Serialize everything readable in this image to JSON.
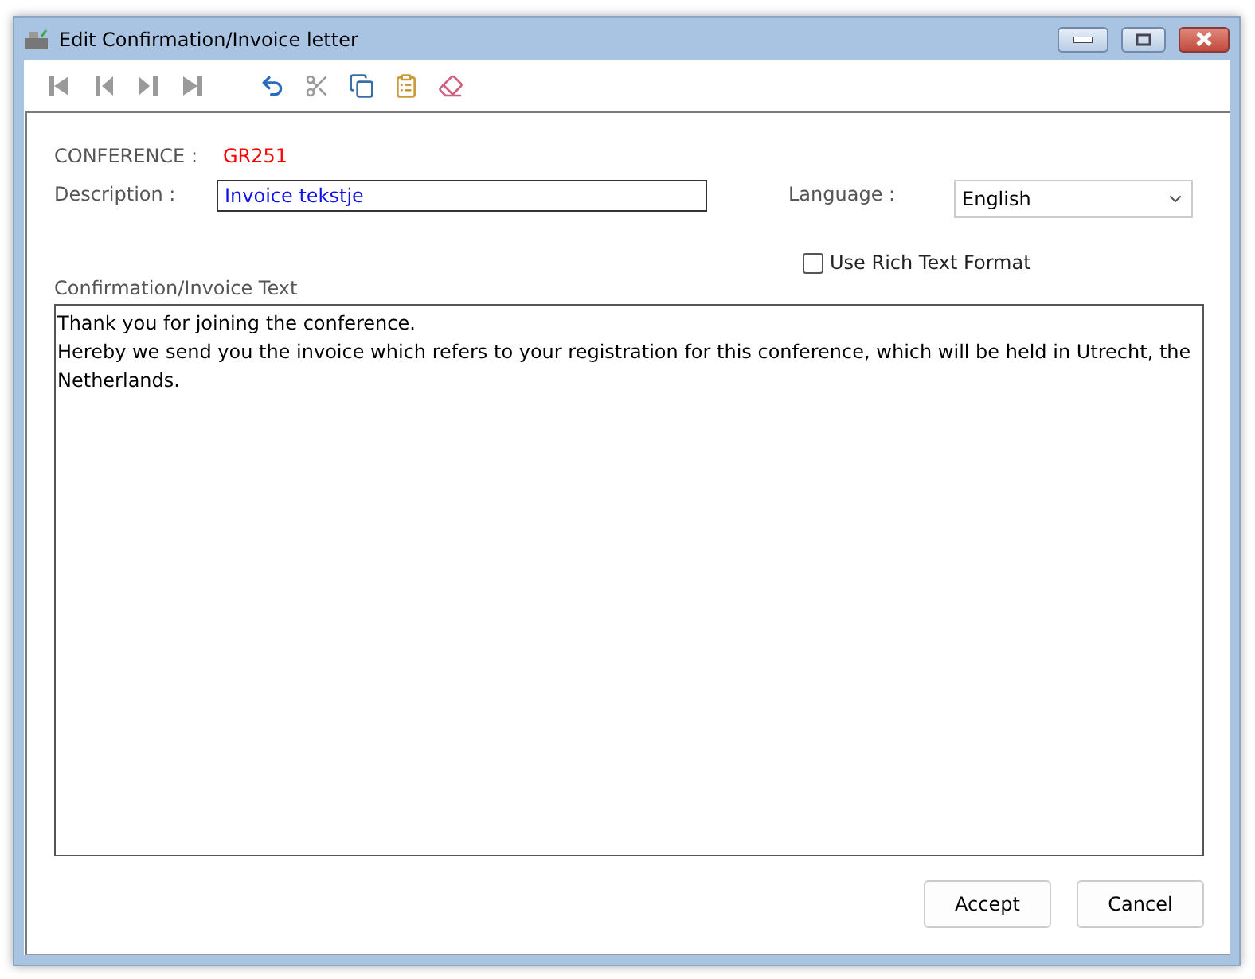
{
  "window": {
    "title": "Edit Confirmation/Invoice letter"
  },
  "toolbar": [
    {
      "kind": "first",
      "disabled": true
    },
    {
      "kind": "prev",
      "disabled": true
    },
    {
      "kind": "next",
      "disabled": true
    },
    {
      "kind": "last",
      "disabled": true
    },
    {
      "kind": "undo",
      "disabled": false
    },
    {
      "kind": "cut",
      "disabled": true
    },
    {
      "kind": "copy",
      "disabled": false
    },
    {
      "kind": "paste",
      "disabled": false
    },
    {
      "kind": "erase",
      "disabled": false
    }
  ],
  "conference": {
    "label": "CONFERENCE :",
    "value": "GR251"
  },
  "description": {
    "label": "Description :",
    "value": "Invoice tekstje"
  },
  "language": {
    "label": "Language :",
    "value": "English"
  },
  "rich_text": {
    "label": "Use Rich Text Format",
    "checked": false
  },
  "text_area": {
    "label": "Confirmation/Invoice Text",
    "lines": [
      "Thank you for joining the conference.",
      "Hereby we send you the invoice which refers to your registration for this conference, which will be held in Utrecht, the Netherlands."
    ]
  },
  "buttons": [
    "Accept",
    "Cancel"
  ]
}
